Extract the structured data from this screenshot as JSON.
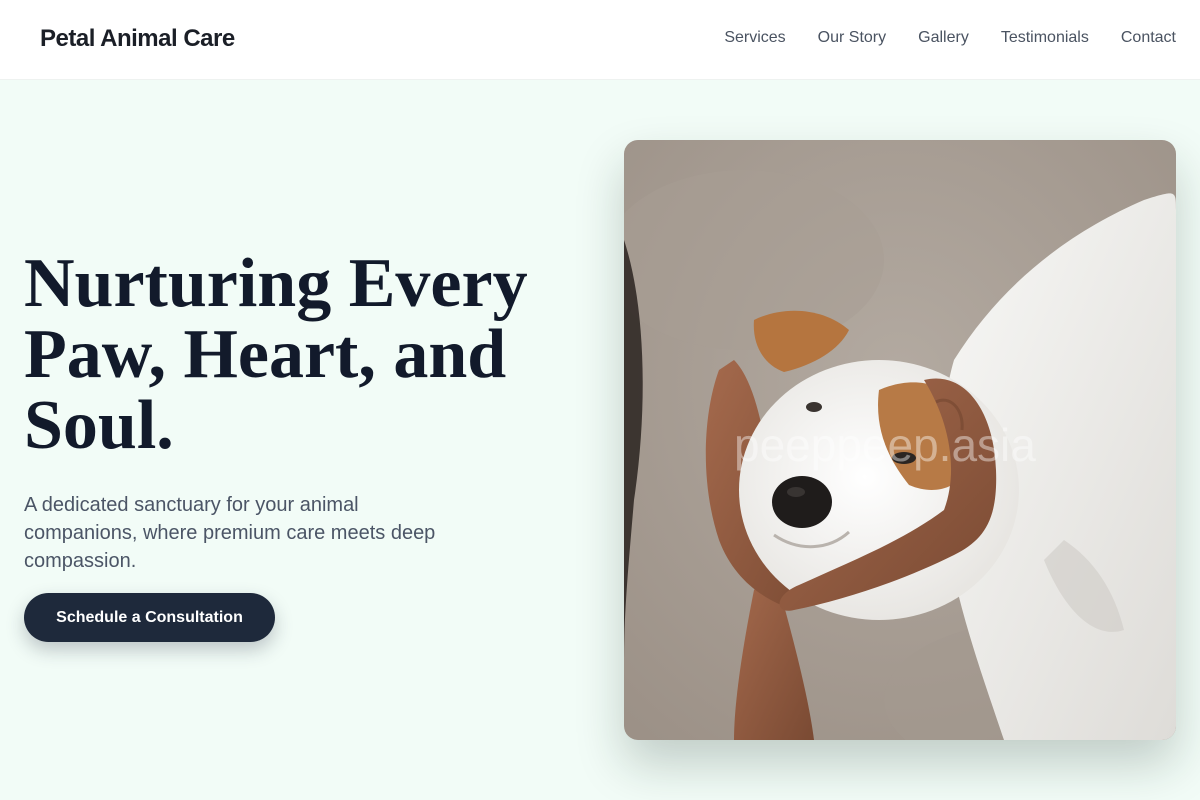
{
  "brand": {
    "name": "Petal Animal Care"
  },
  "nav": {
    "items": [
      {
        "label": "Services"
      },
      {
        "label": "Our Story"
      },
      {
        "label": "Gallery"
      },
      {
        "label": "Testimonials"
      },
      {
        "label": "Contact"
      }
    ]
  },
  "hero": {
    "title": "Nurturing Every Paw, Heart, and Soul.",
    "subtitle": "A dedicated sanctuary for your animal companions, where premium care meets deep compassion.",
    "cta_label": "Schedule a Consultation",
    "image": {
      "subject": "white puppy with brown ear patches held by human hands",
      "watermark": "peeppeep.asia"
    }
  },
  "colors": {
    "page_background": "#f2fcf7",
    "nav_background": "#ffffff",
    "heading": "#121a2b",
    "body_text": "#4b5566",
    "cta_background": "#1e293b",
    "cta_text": "#ffffff"
  }
}
